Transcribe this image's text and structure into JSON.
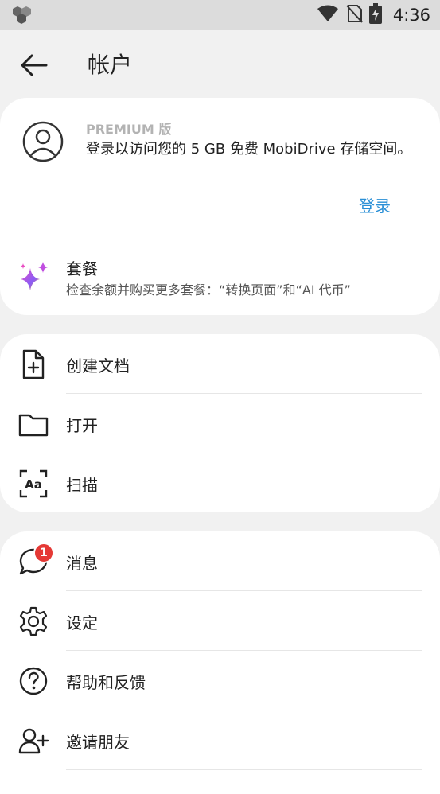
{
  "status_bar": {
    "time": "4:36"
  },
  "header": {
    "title": "帐户"
  },
  "premium": {
    "label": "PREMIUM 版",
    "description": "登录以访问您的 5 GB 免费 MobiDrive 存储空间。",
    "login_label": "登录"
  },
  "plans": {
    "title": "套餐",
    "subtitle": "检查余额并购买更多套餐：“转换页面”和“AI 代币”"
  },
  "file_actions": [
    {
      "label": "创建文档",
      "icon": "new-document-icon"
    },
    {
      "label": "打开",
      "icon": "folder-icon"
    },
    {
      "label": "扫描",
      "icon": "scan-text-icon"
    }
  ],
  "more_actions": [
    {
      "label": "消息",
      "icon": "chat-bubble-icon",
      "badge": "1"
    },
    {
      "label": "设定",
      "icon": "gear-icon"
    },
    {
      "label": "帮助和反馈",
      "icon": "help-circle-icon"
    },
    {
      "label": "邀请朋友",
      "icon": "add-person-icon"
    }
  ],
  "colors": {
    "accent": "#2a8fd6",
    "badge": "#e53935",
    "background": "#f1f1f1",
    "card": "#ffffff"
  }
}
